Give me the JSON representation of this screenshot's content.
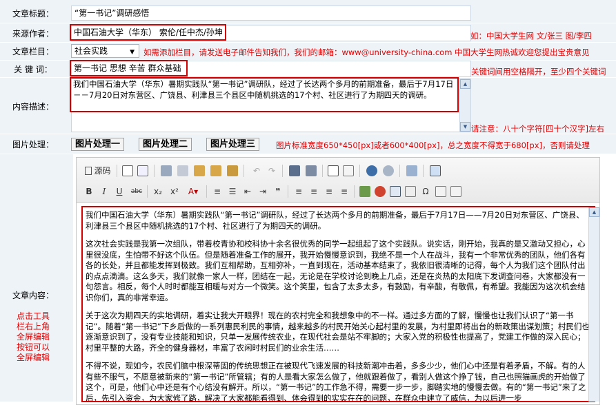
{
  "fields": {
    "title": {
      "label": "文章标题：",
      "value": "“第一书记”调研感悟"
    },
    "source": {
      "label": "来源作者：",
      "value": "中国石油大学（华东） 索伦/任中杰/孙坤",
      "hint": "如：中国大学生网 文/张三 图/李四"
    },
    "column": {
      "label": "文章栏目：",
      "value": "社会实践",
      "hint": "如需添加栏目，请发送电子邮件告知我们，我们的邮箱：www@university-china.com 中国大学生网热诚欢迎您提出宝贵意见"
    },
    "keywords": {
      "label": "关 键 词：",
      "value": "第一书记 思想 辛苦 群众基础",
      "hint": "关键词间用空格隔开，至少四个关键词"
    },
    "summary": {
      "label": "内容描述：",
      "value": "我们中国石油大学（华东）暑期实践队“第一书记”调研队，经过了长达两个多月的前期准备，最后于7月17日－－7月20日对东营区、广饶县、利津县三个县区中随机挑选的17个村、社区进行了为期四天的调研。",
      "hint": "请注意：八十个字符[四十个汉字]左右"
    },
    "image": {
      "label": "图片处理：",
      "buttons": [
        "图片处理一",
        "图片处理二",
        "图片处理三"
      ],
      "hint": "图片标准宽度650*450[px]或者600*400[px]，总之宽度不得宽于680[px]，否则请处理"
    },
    "content": {
      "label": "文章内容：",
      "side_note": [
        "点击工具",
        "栏右上角",
        "全屏编辑",
        "按钮可以",
        "全屏编辑"
      ]
    }
  },
  "toolbar": {
    "source_label": "源码"
  },
  "article": [
    "我们中国石油大学（华东）暑期实践队“第一书记”调研队，经过了长达两个多月的前期准备，最后于7月17日——7月20日对东营区、广饶县、利津县三个县区中随机挑选的17个村、社区进行了为期四天的调研。",
    "这次社会实践是我第一次组队，带着校青协和校科协十余名很优秀的同学一起组起了这个实践队。说实话，刚开始，我真的是又激动又担心，心里很没底，生怕带不好这个队伍。但是随着准备工作的展开，我开始慢慢意识到，我绝不是一个人在战斗，我有一个非常优秀的团队，他们各有各的长处，并且都能发挥到极致。我们互相帮助，互相弥补，一直到现在，活动基本结束了，我依旧很清晰的记得，每个人为我们这个团队付出的点点滴滴。这么多天，我们就像一家人一样，团结在一起，无论是在学校讨论到晚上几点，还是在炎热的太阳底下发调查问卷，大家都没有一句怨言。相反，每个人时时都能互相暖与对方一个微笑。这个笑里，包含了太多太多，有鼓励，有辛酸，有敬佩，有希望。我能因为这次机会结识你们，真的非常幸运。",
    "关于这次为期四天的实地调研，着实让我大开眼界！现在的农村完全和我想象中的不一样。通过多方面的了解，慢慢也让我们认识了“第一书记”。随着“第一书记”下乡后做的一系列惠民利民的事情，越来越多的村民开始关心起村里的发展，为村里即将出台的新政策出谋划策；村民们也逐渐意识到了，没有专业技能和知识，只单一发展传统农业，在现代社会是站不牢脚的；大家入党的积极性也提高了，党建工作做的深入民心；村里平整的大路，齐全的健身器材，丰富了农闲时村民们的业余生活……",
    "不得不说，现如今，农民们脑中根深蒂固的传统思想正在被现代飞速发展的科技新潮冲击着，多多少少，他们心中还是有着矛盾，不解。有的人有些不服气，不愿意被新来的“第一书记”所管辖；有的人是看大家怎么做了，他就跟着做了，看别人做这个挣了钱，自己也照猫画虎的开始做了这个，可是，他们心中还是有个心结没有解开。所以，“第一书记”的工作急不得，需要一步一步，脚踏实地的慢慢去做。有的“第一书记”来了之后，先引入资金，为大家修了路，解决了大家都能看得到、体会得到的实实在在的问题，在群众中建立了威信，为以后进一步"
  ]
}
